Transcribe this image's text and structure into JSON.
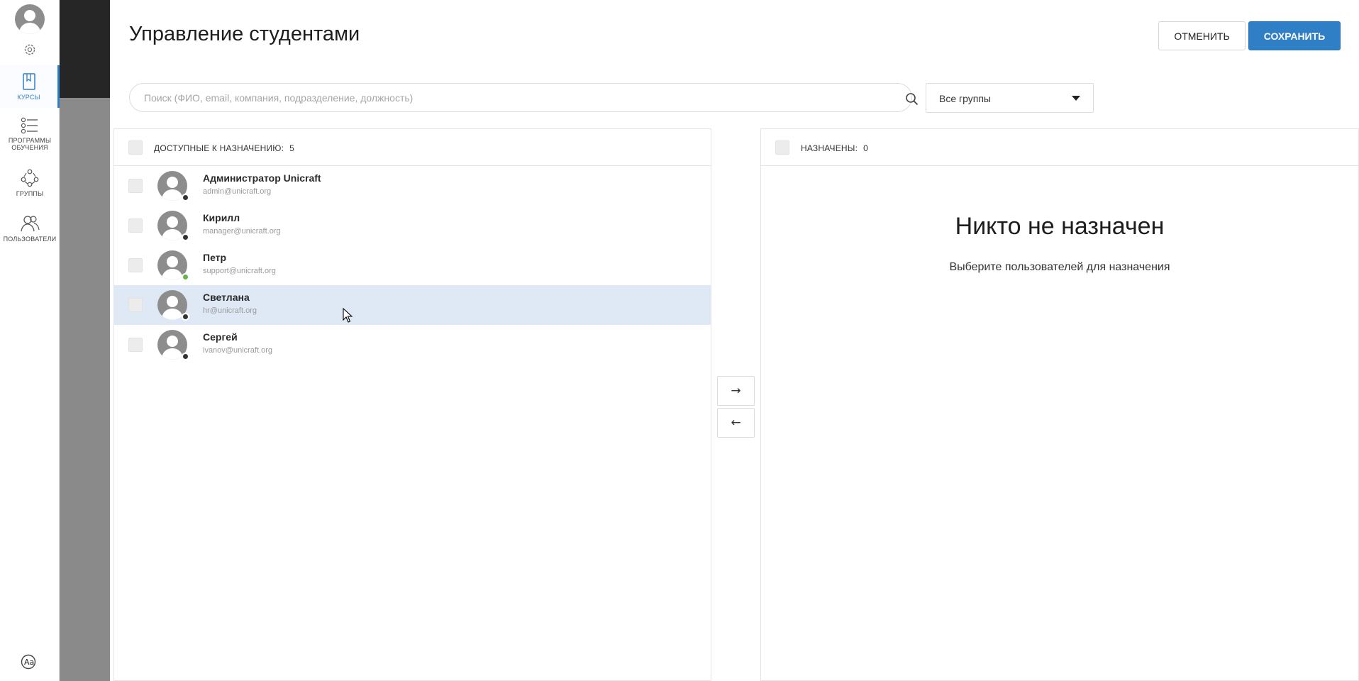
{
  "sidebar": {
    "items": [
      {
        "label": "КУРСЫ",
        "icon": "book-icon"
      },
      {
        "label": "ПРОГРАММЫ ОБУЧЕНИЯ",
        "icon": "list-checklist-icon"
      },
      {
        "label": "ГРУППЫ",
        "icon": "group-network-icon"
      },
      {
        "label": "ПОЛЬЗОВАТЕЛИ",
        "icon": "users-icon"
      }
    ],
    "active": "КУРСЫ",
    "accent_color": "#2f7fc7"
  },
  "header": {
    "title": "Управление студентами",
    "cancel_label": "ОТМЕНИТЬ",
    "save_label": "СОХРАНИТЬ"
  },
  "search": {
    "placeholder": "Поиск (ФИО, email, компания, подразделение, должность)",
    "value": ""
  },
  "group_filter": {
    "selected": "Все группы"
  },
  "available": {
    "label": "ДОСТУПНЫЕ К НАЗНАЧЕНИЮ:",
    "count": "5",
    "users": [
      {
        "name": "Администратор Unicraft",
        "email": "admin@unicraft.org",
        "status": "offline"
      },
      {
        "name": "Кирилл",
        "email": "manager@unicraft.org",
        "status": "offline"
      },
      {
        "name": "Петр",
        "email": "support@unicraft.org",
        "status": "online"
      },
      {
        "name": "Светлана",
        "email": "hr@unicraft.org",
        "status": "offline"
      },
      {
        "name": "Сергей",
        "email": "ivanov@unicraft.org",
        "status": "offline"
      }
    ]
  },
  "assigned": {
    "label": "НАЗНАЧЕНЫ:",
    "count": "0",
    "empty_title": "Никто не назначен",
    "empty_subtitle": "Выберите пользователей для назначения"
  },
  "transfer": {
    "right_arrow": "→",
    "left_arrow": "←"
  }
}
